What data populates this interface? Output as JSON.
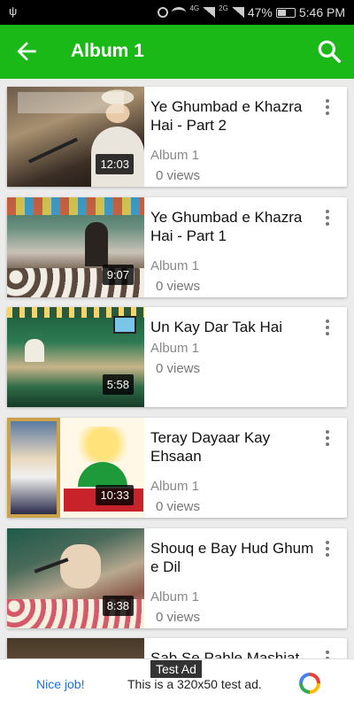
{
  "status_bar": {
    "usb_glyph": "ψ",
    "network_label": "4G",
    "network2_label": "2G",
    "battery": "47%",
    "time": "5:46 PM"
  },
  "app_bar": {
    "title": "Album 1",
    "accent_color": "#1ab917"
  },
  "videos": [
    {
      "title": "Ye Ghumbad e Khazra Hai - Part 2",
      "album": "Album 1",
      "views": "0 views",
      "duration": "12:03"
    },
    {
      "title": "Ye Ghumbad e Khazra Hai - Part 1",
      "album": "Album 1",
      "views": "0 views",
      "duration": "9:07"
    },
    {
      "title": "Un Kay Dar Tak Hai",
      "album": "Album 1",
      "views": "0 views",
      "duration": "5:58"
    },
    {
      "title": "Teray Dayaar Kay Ehsaan",
      "album": "Album 1",
      "views": "0 views",
      "duration": "10:33"
    },
    {
      "title": "Shouq e Bay Hud Ghum e Dil",
      "album": "Album 1",
      "views": "0 views",
      "duration": "8:38"
    },
    {
      "title": "Sab Se Pahle Mashiat"
    }
  ],
  "ad": {
    "label": "Test Ad",
    "cta": "Nice job!",
    "message": "This is a 320x50 test ad."
  }
}
